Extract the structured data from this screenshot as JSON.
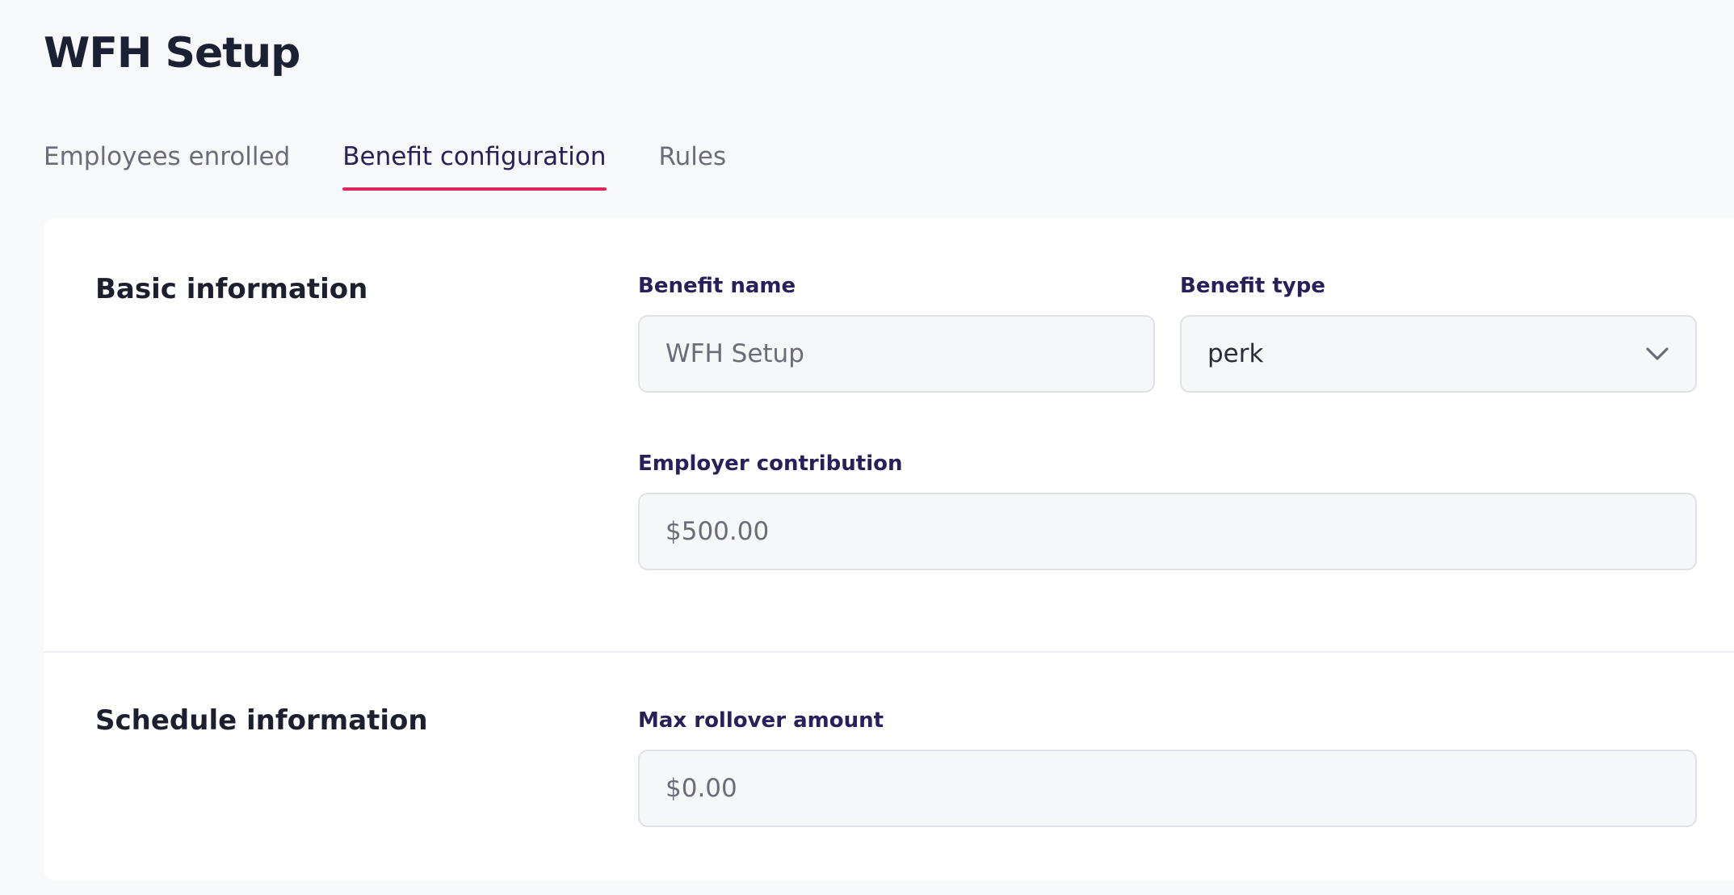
{
  "page": {
    "title": "WFH Setup"
  },
  "tabs": [
    {
      "label": "Employees enrolled",
      "active": false
    },
    {
      "label": "Benefit configuration",
      "active": true
    },
    {
      "label": "Rules",
      "active": false
    }
  ],
  "basic_info": {
    "title": "Basic information",
    "benefit_name": {
      "label": "Benefit name",
      "value": "WFH Setup"
    },
    "benefit_type": {
      "label": "Benefit type",
      "value": "perk",
      "icon": "chevron-down-icon"
    },
    "employer_contribution": {
      "label": "Employer contribution",
      "value": "$500.00"
    }
  },
  "schedule_info": {
    "title": "Schedule information",
    "max_rollover": {
      "label": "Max rollover amount",
      "value": "$0.00"
    }
  },
  "colors": {
    "accent": "#e0245e",
    "label": "#27205a",
    "background": "#f7f8fa"
  }
}
